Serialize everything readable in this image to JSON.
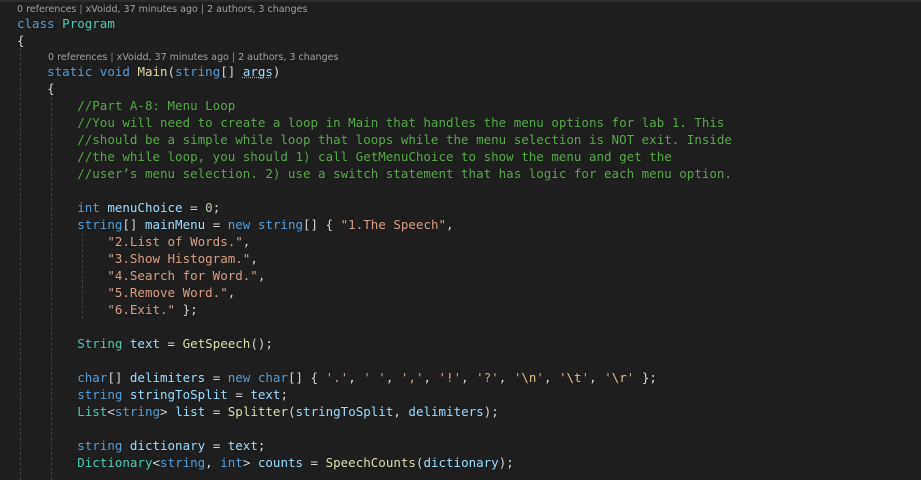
{
  "codelens": {
    "class": {
      "references": "0 references",
      "author": "xVoidd, 37 minutes ago",
      "changes": "2 authors, 3 changes"
    },
    "main": {
      "references": "0 references",
      "author": "xVoidd, 37 minutes ago",
      "changes": "2 authors, 3 changes"
    }
  },
  "lens_separator": " | ",
  "colors": {
    "background": "#1e1e1e",
    "keyword": "#569cd6",
    "type": "#4ec9b0",
    "method": "#dcdcaa",
    "variable": "#9cdcfe",
    "string": "#d69d85",
    "escape": "#e2c08d",
    "comment": "#57a64a",
    "number": "#b5cea8",
    "text": "#d4d4d4"
  },
  "code_lines": [
    {
      "name": "class-declaration-line",
      "tokens": [
        {
          "t": "class",
          "k": "kw"
        },
        {
          "t": " "
        },
        {
          "t": "Program",
          "k": "type"
        }
      ]
    },
    {
      "name": "class-open-brace-line",
      "tokens": [
        {
          "t": "{",
          "k": "pun"
        }
      ]
    },
    {
      "name": "main-signature-line",
      "tokens": [
        {
          "t": "    "
        },
        {
          "t": "static",
          "k": "kw"
        },
        {
          "t": " "
        },
        {
          "t": "void",
          "k": "kw"
        },
        {
          "t": " "
        },
        {
          "t": "Main",
          "k": "fn"
        },
        {
          "t": "(",
          "k": "pun"
        },
        {
          "t": "string",
          "k": "kw"
        },
        {
          "t": "[] ",
          "k": "pun"
        },
        {
          "t": "args",
          "k": "args"
        },
        {
          "t": ")",
          "k": "pun"
        }
      ]
    },
    {
      "name": "main-open-brace-line",
      "tokens": [
        {
          "t": "    "
        },
        {
          "t": "{",
          "k": "pun"
        }
      ]
    },
    {
      "name": "comment-line-1",
      "tokens": [
        {
          "t": "        "
        },
        {
          "t": "//Part A-8: Menu Loop",
          "k": "cm"
        }
      ]
    },
    {
      "name": "comment-line-2",
      "tokens": [
        {
          "t": "        "
        },
        {
          "t": "//You will need to create a loop in Main that handles the menu options for lab 1. This",
          "k": "cm"
        }
      ]
    },
    {
      "name": "comment-line-3",
      "tokens": [
        {
          "t": "        "
        },
        {
          "t": "//should be a simple while loop that loops while the menu selection is NOT exit. Inside",
          "k": "cm"
        }
      ]
    },
    {
      "name": "comment-line-4",
      "tokens": [
        {
          "t": "        "
        },
        {
          "t": "//the while loop, you should 1) call GetMenuChoice to show the menu and get the",
          "k": "cm"
        }
      ]
    },
    {
      "name": "comment-line-5",
      "tokens": [
        {
          "t": "        "
        },
        {
          "t": "//user’s menu selection. 2) use a switch statement that has logic for each menu option.",
          "k": "cm"
        }
      ]
    },
    {
      "name": "blank-line",
      "tokens": []
    },
    {
      "name": "menu-choice-line",
      "tokens": [
        {
          "t": "        "
        },
        {
          "t": "int",
          "k": "kw"
        },
        {
          "t": " "
        },
        {
          "t": "menuChoice",
          "k": "var"
        },
        {
          "t": " = ",
          "k": "pun"
        },
        {
          "t": "0",
          "k": "num"
        },
        {
          "t": ";",
          "k": "pun"
        }
      ]
    },
    {
      "name": "main-menu-line",
      "tokens": [
        {
          "t": "        "
        },
        {
          "t": "string",
          "k": "kw"
        },
        {
          "t": "[] ",
          "k": "pun"
        },
        {
          "t": "mainMenu",
          "k": "var"
        },
        {
          "t": " = ",
          "k": "pun"
        },
        {
          "t": "new",
          "k": "kw"
        },
        {
          "t": " "
        },
        {
          "t": "string",
          "k": "kw"
        },
        {
          "t": "[] { ",
          "k": "pun"
        },
        {
          "t": "\"1.The Speech\"",
          "k": "str"
        },
        {
          "t": ",",
          "k": "pun"
        }
      ]
    },
    {
      "name": "menu-item-line-2",
      "tokens": [
        {
          "t": "            "
        },
        {
          "t": "\"2.List of Words.\"",
          "k": "str"
        },
        {
          "t": ",",
          "k": "pun"
        }
      ]
    },
    {
      "name": "menu-item-line-3",
      "tokens": [
        {
          "t": "            "
        },
        {
          "t": "\"3.Show Histogram.\"",
          "k": "str"
        },
        {
          "t": ",",
          "k": "pun"
        }
      ]
    },
    {
      "name": "menu-item-line-4",
      "tokens": [
        {
          "t": "            "
        },
        {
          "t": "\"4.Search for Word.\"",
          "k": "str"
        },
        {
          "t": ",",
          "k": "pun"
        }
      ]
    },
    {
      "name": "menu-item-line-5",
      "tokens": [
        {
          "t": "            "
        },
        {
          "t": "\"5.Remove Word.\"",
          "k": "str"
        },
        {
          "t": ",",
          "k": "pun"
        }
      ]
    },
    {
      "name": "menu-item-line-6",
      "tokens": [
        {
          "t": "            "
        },
        {
          "t": "\"6.Exit.\"",
          "k": "str"
        },
        {
          "t": " };",
          "k": "pun"
        }
      ]
    },
    {
      "name": "blank-line",
      "tokens": []
    },
    {
      "name": "get-speech-line",
      "tokens": [
        {
          "t": "        "
        },
        {
          "t": "String",
          "k": "type"
        },
        {
          "t": " "
        },
        {
          "t": "text",
          "k": "var"
        },
        {
          "t": " = ",
          "k": "pun"
        },
        {
          "t": "GetSpeech",
          "k": "fn"
        },
        {
          "t": "();",
          "k": "pun"
        }
      ]
    },
    {
      "name": "blank-line",
      "tokens": []
    },
    {
      "name": "delimiters-line",
      "tokens": [
        {
          "t": "        "
        },
        {
          "t": "char",
          "k": "kw"
        },
        {
          "t": "[] ",
          "k": "pun"
        },
        {
          "t": "delimiters",
          "k": "var"
        },
        {
          "t": " = ",
          "k": "pun"
        },
        {
          "t": "new",
          "k": "kw"
        },
        {
          "t": " "
        },
        {
          "t": "char",
          "k": "kw"
        },
        {
          "t": "[] { ",
          "k": "pun"
        },
        {
          "t": "'.'",
          "k": "str"
        },
        {
          "t": ", ",
          "k": "pun"
        },
        {
          "t": "' '",
          "k": "str"
        },
        {
          "t": ", ",
          "k": "pun"
        },
        {
          "t": "','",
          "k": "str"
        },
        {
          "t": ", ",
          "k": "pun"
        },
        {
          "t": "'!'",
          "k": "str"
        },
        {
          "t": ", ",
          "k": "pun"
        },
        {
          "t": "'?'",
          "k": "str"
        },
        {
          "t": ", ",
          "k": "pun"
        },
        {
          "t": "'",
          "k": "str"
        },
        {
          "t": "\\n",
          "k": "esc"
        },
        {
          "t": "'",
          "k": "str"
        },
        {
          "t": ", ",
          "k": "pun"
        },
        {
          "t": "'",
          "k": "str"
        },
        {
          "t": "\\t",
          "k": "esc"
        },
        {
          "t": "'",
          "k": "str"
        },
        {
          "t": ", ",
          "k": "pun"
        },
        {
          "t": "'",
          "k": "str"
        },
        {
          "t": "\\r",
          "k": "esc"
        },
        {
          "t": "'",
          "k": "str"
        },
        {
          "t": " };",
          "k": "pun"
        }
      ]
    },
    {
      "name": "string-to-split-line",
      "tokens": [
        {
          "t": "        "
        },
        {
          "t": "string",
          "k": "kw"
        },
        {
          "t": " "
        },
        {
          "t": "stringToSplit",
          "k": "var"
        },
        {
          "t": " = ",
          "k": "pun"
        },
        {
          "t": "text",
          "k": "var"
        },
        {
          "t": ";",
          "k": "pun"
        }
      ]
    },
    {
      "name": "splitter-line",
      "tokens": [
        {
          "t": "        "
        },
        {
          "t": "List",
          "k": "type"
        },
        {
          "t": "<",
          "k": "pun"
        },
        {
          "t": "string",
          "k": "kw"
        },
        {
          "t": "> ",
          "k": "pun"
        },
        {
          "t": "list",
          "k": "var"
        },
        {
          "t": " = ",
          "k": "pun"
        },
        {
          "t": "Splitter",
          "k": "fn"
        },
        {
          "t": "(",
          "k": "pun"
        },
        {
          "t": "stringToSplit",
          "k": "var"
        },
        {
          "t": ", ",
          "k": "pun"
        },
        {
          "t": "delimiters",
          "k": "var"
        },
        {
          "t": ");",
          "k": "pun"
        }
      ]
    },
    {
      "name": "blank-line",
      "tokens": []
    },
    {
      "name": "dictionary-line",
      "tokens": [
        {
          "t": "        "
        },
        {
          "t": "string",
          "k": "kw"
        },
        {
          "t": " "
        },
        {
          "t": "dictionary",
          "k": "var"
        },
        {
          "t": " = ",
          "k": "pun"
        },
        {
          "t": "text",
          "k": "var"
        },
        {
          "t": ";",
          "k": "pun"
        }
      ]
    },
    {
      "name": "speech-counts-line",
      "tokens": [
        {
          "t": "        "
        },
        {
          "t": "Dictionary",
          "k": "type"
        },
        {
          "t": "<",
          "k": "pun"
        },
        {
          "t": "string",
          "k": "kw"
        },
        {
          "t": ", ",
          "k": "pun"
        },
        {
          "t": "int",
          "k": "kw"
        },
        {
          "t": "> ",
          "k": "pun"
        },
        {
          "t": "counts",
          "k": "var"
        },
        {
          "t": " = ",
          "k": "pun"
        },
        {
          "t": "SpeechCounts",
          "k": "fn"
        },
        {
          "t": "(",
          "k": "pun"
        },
        {
          "t": "dictionary",
          "k": "var"
        },
        {
          "t": ");",
          "k": "pun"
        }
      ]
    }
  ]
}
